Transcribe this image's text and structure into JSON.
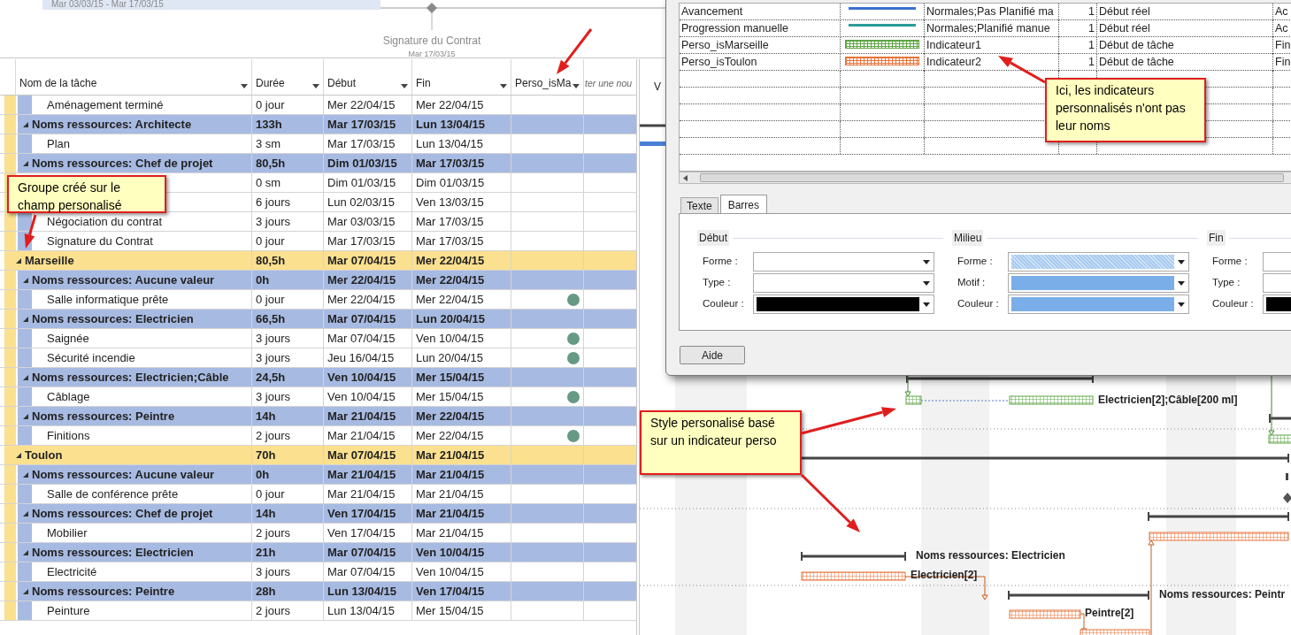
{
  "timeline": {
    "range_label": "Mar 03/03/15 - Mar 17/03/15",
    "milestone_label": "Signature du Contrat",
    "milestone_date": "Mar 17/03/15"
  },
  "table": {
    "columns": [
      "Nom de la tâche",
      "Durée",
      "Début",
      "Fin",
      "Perso_isMa",
      "ter une nou"
    ],
    "rows": [
      {
        "kind": "task",
        "name": "Aménagement terminé",
        "duration": "0 jour",
        "start": "Mer 22/04/15",
        "finish": "Mer 22/04/15",
        "indicator": false
      },
      {
        "kind": "resource",
        "name": "Noms ressources: Architecte",
        "duration": "133h",
        "start": "Mar 17/03/15",
        "finish": "Lun 13/04/15",
        "indicator": false
      },
      {
        "kind": "task",
        "name": "Plan",
        "duration": "3 sm",
        "start": "Mar 17/03/15",
        "finish": "Lun 13/04/15",
        "indicator": false
      },
      {
        "kind": "resource",
        "name": "Noms ressources: Chef de projet",
        "duration": "80,5h",
        "start": "Dim 01/03/15",
        "finish": "Mar 17/03/15",
        "indicator": false
      },
      {
        "kind": "task",
        "duration": "0 sm",
        "start": "Dim 01/03/15",
        "finish": "Dim 01/03/15",
        "indicator": false
      },
      {
        "kind": "task",
        "duration": "6 jours",
        "start": "Lun 02/03/15",
        "finish": "Ven 13/03/15",
        "indicator": false
      },
      {
        "kind": "task",
        "name": "Négociation du contrat",
        "duration": "3 jours",
        "start": "Mar 03/03/15",
        "finish": "Mar 17/03/15",
        "indicator": false
      },
      {
        "kind": "task",
        "name": "Signature du Contrat",
        "duration": "0 jour",
        "start": "Mar 17/03/15",
        "finish": "Mar 17/03/15",
        "indicator": false
      },
      {
        "kind": "city",
        "name": "Marseille",
        "duration": "80,5h",
        "start": "Mar 07/04/15",
        "finish": "Mer 22/04/15",
        "indicator": false
      },
      {
        "kind": "resource",
        "name": "Noms ressources: Aucune valeur",
        "duration": "0h",
        "start": "Mer 22/04/15",
        "finish": "Mer 22/04/15",
        "indicator": false
      },
      {
        "kind": "task",
        "name": "Salle informatique prête",
        "duration": "0 jour",
        "start": "Mer 22/04/15",
        "finish": "Mer 22/04/15",
        "indicator": true
      },
      {
        "kind": "resource",
        "name": "Noms ressources: Electricien",
        "duration": "66,5h",
        "start": "Mar 07/04/15",
        "finish": "Lun 20/04/15",
        "indicator": false
      },
      {
        "kind": "task",
        "name": "Saignée",
        "duration": "3 jours",
        "start": "Mar 07/04/15",
        "finish": "Ven 10/04/15",
        "indicator": true
      },
      {
        "kind": "task",
        "name": "Sécurité incendie",
        "duration": "3 jours",
        "start": "Jeu 16/04/15",
        "finish": "Lun 20/04/15",
        "indicator": true
      },
      {
        "kind": "resource",
        "name": "Noms ressources: Electricien;Câble",
        "duration": "24,5h",
        "start": "Ven 10/04/15",
        "finish": "Mer 15/04/15",
        "indicator": false
      },
      {
        "kind": "task",
        "name": "Câblage",
        "duration": "3 jours",
        "start": "Ven 10/04/15",
        "finish": "Mer 15/04/15",
        "indicator": true
      },
      {
        "kind": "resource",
        "name": "Noms ressources: Peintre",
        "duration": "14h",
        "start": "Mar 21/04/15",
        "finish": "Mer 22/04/15",
        "indicator": false
      },
      {
        "kind": "task",
        "name": "Finitions",
        "duration": "2 jours",
        "start": "Mar 21/04/15",
        "finish": "Mer 22/04/15",
        "indicator": true
      },
      {
        "kind": "city",
        "name": "Toulon",
        "duration": "70h",
        "start": "Mar 07/04/15",
        "finish": "Mar 21/04/15",
        "indicator": false
      },
      {
        "kind": "resource",
        "name": "Noms ressources: Aucune valeur",
        "duration": "0h",
        "start": "Mar 21/04/15",
        "finish": "Mar 21/04/15",
        "indicator": false
      },
      {
        "kind": "task",
        "name": "Salle de conférence prête",
        "duration": "0 jour",
        "start": "Mar 21/04/15",
        "finish": "Mar 21/04/15",
        "indicator": false
      },
      {
        "kind": "resource",
        "name": "Noms ressources: Chef de projet",
        "duration": "14h",
        "start": "Ven 17/04/15",
        "finish": "Mar 21/04/15",
        "indicator": false
      },
      {
        "kind": "task",
        "name": "Mobilier",
        "duration": "2 jours",
        "start": "Ven 17/04/15",
        "finish": "Mar 21/04/15",
        "indicator": false
      },
      {
        "kind": "resource",
        "name": "Noms ressources: Electricien",
        "duration": "21h",
        "start": "Mar 07/04/15",
        "finish": "Ven 10/04/15",
        "indicator": false
      },
      {
        "kind": "task",
        "name": "Electricité",
        "duration": "3 jours",
        "start": "Mar 07/04/15",
        "finish": "Ven 10/04/15",
        "indicator": false
      },
      {
        "kind": "resource",
        "name": "Noms ressources: Peintre",
        "duration": "28h",
        "start": "Lun 13/04/15",
        "finish": "Ven 17/04/15",
        "indicator": false
      },
      {
        "kind": "task",
        "name": "Peinture",
        "duration": "2 jours",
        "start": "Lun 13/04/15",
        "finish": "Mer 15/04/15",
        "indicator": false
      }
    ]
  },
  "gantt": {
    "header": "V",
    "labels": [
      "Electricien[2];Câble[200 ml]",
      "Noms ressources: Electricien",
      "Electricien[2]",
      "Noms ressources: Peintr",
      "Peintre[2]"
    ]
  },
  "dialog": {
    "bar_styles": [
      {
        "name": "Avancement",
        "appearance": {
          "kind": "line",
          "color": "#3a6fd0"
        },
        "show_for": "Normales;Pas Planifié ma",
        "row": "1",
        "from": "Début réel",
        "to": "Ac"
      },
      {
        "name": "Progression manuelle",
        "appearance": {
          "kind": "line",
          "color": "#2a9d9a"
        },
        "show_for": "Normales;Planifié manue",
        "row": "1",
        "from": "Début réel",
        "to": "Ac"
      },
      {
        "name": "Perso_isMarseille",
        "appearance": {
          "kind": "hatched",
          "color": "#5da544"
        },
        "show_for": "Indicateur1",
        "row": "1",
        "from": "Début de tâche",
        "to": "Fin"
      },
      {
        "name": "Perso_isToulon",
        "appearance": {
          "kind": "hatched",
          "color": "#e8733a"
        },
        "show_for": "Indicateur2",
        "row": "1",
        "from": "Début de tâche",
        "to": "Fin"
      }
    ],
    "tabs": [
      {
        "label": "Texte",
        "selected": false
      },
      {
        "label": "Barres",
        "selected": true
      }
    ],
    "groups": [
      {
        "title": "Début",
        "fields": [
          {
            "label": "Forme :"
          },
          {
            "label": "Type :"
          },
          {
            "label": "Couleur :",
            "swatch": {
              "kind": "solid",
              "color": "#000000"
            }
          }
        ]
      },
      {
        "title": "Milieu",
        "fields": [
          {
            "label": "Forme :",
            "swatch": {
              "kind": "hatched",
              "color": "#a9cbf0"
            }
          },
          {
            "label": "Motif :",
            "swatch": {
              "kind": "solid",
              "color": "#7aaee8"
            }
          },
          {
            "label": "Couleur :",
            "swatch": {
              "kind": "solid",
              "color": "#7aaee8"
            }
          }
        ]
      },
      {
        "title": "Fin",
        "fields": [
          {
            "label": "Forme :"
          },
          {
            "label": "Type :"
          },
          {
            "label": "Couleur :",
            "swatch": {
              "kind": "solid",
              "color": "#000000"
            }
          }
        ]
      }
    ],
    "help_button": "Aide"
  },
  "callouts": [
    "Groupe créé sur le champ personalisé",
    "Ici, les indicateurs personnalisés n'ont pas leur noms",
    "Style personalisé basé sur un indicateur perso"
  ]
}
